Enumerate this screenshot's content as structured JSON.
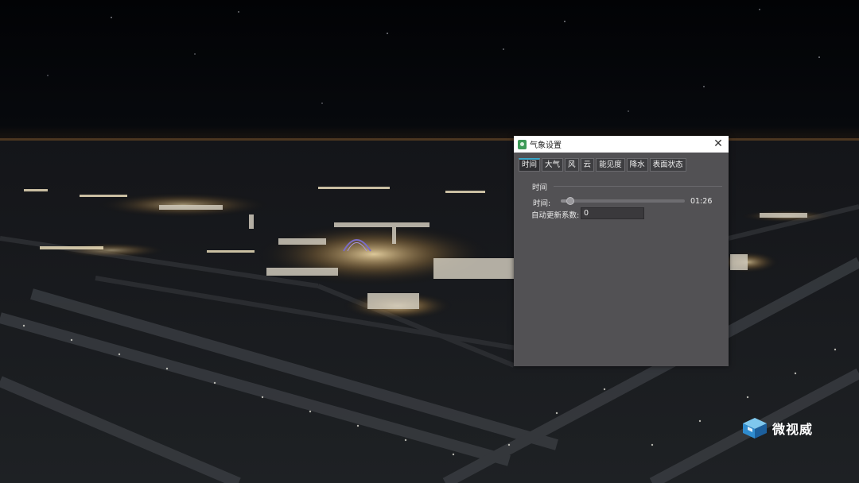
{
  "dialog": {
    "title": "气象设置",
    "tabs": [
      {
        "label": "时间",
        "active": true
      },
      {
        "label": "大气",
        "active": false
      },
      {
        "label": "风",
        "active": false
      },
      {
        "label": "云",
        "active": false
      },
      {
        "label": "能见度",
        "active": false
      },
      {
        "label": "降水",
        "active": false
      },
      {
        "label": "表面状态",
        "active": false
      }
    ],
    "group_title": "时间",
    "time_label": "时间:",
    "time_slider_fraction": 0.07,
    "time_value": "01:26",
    "coef_label": "自动更新系数:",
    "coef_value": "0"
  },
  "watermark": {
    "text": "微视威"
  },
  "colors": {
    "dialog_bg": "#525154",
    "tab_accent": "#3aa7c9",
    "icon_green": "#3d9a58"
  }
}
